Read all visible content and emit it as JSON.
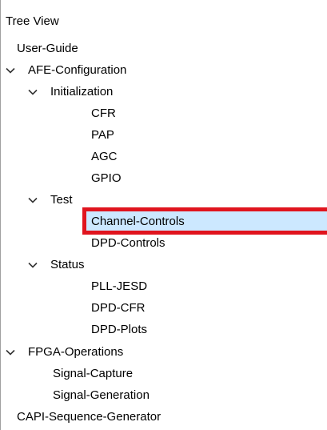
{
  "tree_view": {
    "title": "Tree View",
    "nodes": {
      "user_guide": "User-Guide",
      "afe_configuration": "AFE-Configuration",
      "initialization": "Initialization",
      "cfr": "CFR",
      "pap": "PAP",
      "agc": "AGC",
      "gpio": "GPIO",
      "test": "Test",
      "channel_controls": "Channel-Controls",
      "dpd_controls": "DPD-Controls",
      "status": "Status",
      "pll_jesd": "PLL-JESD",
      "dpd_cfr": "DPD-CFR",
      "dpd_plots": "DPD-Plots",
      "fpga_operations": "FPGA-Operations",
      "signal_capture": "Signal-Capture",
      "signal_generation": "Signal-Generation",
      "capi_sequence_generator": "CAPI-Sequence-Generator"
    },
    "selected": "Channel-Controls",
    "expand_icon": "chevron-down-icon",
    "colors": {
      "selection_background": "#cce8ff",
      "highlight_border": "#e0141e"
    }
  }
}
